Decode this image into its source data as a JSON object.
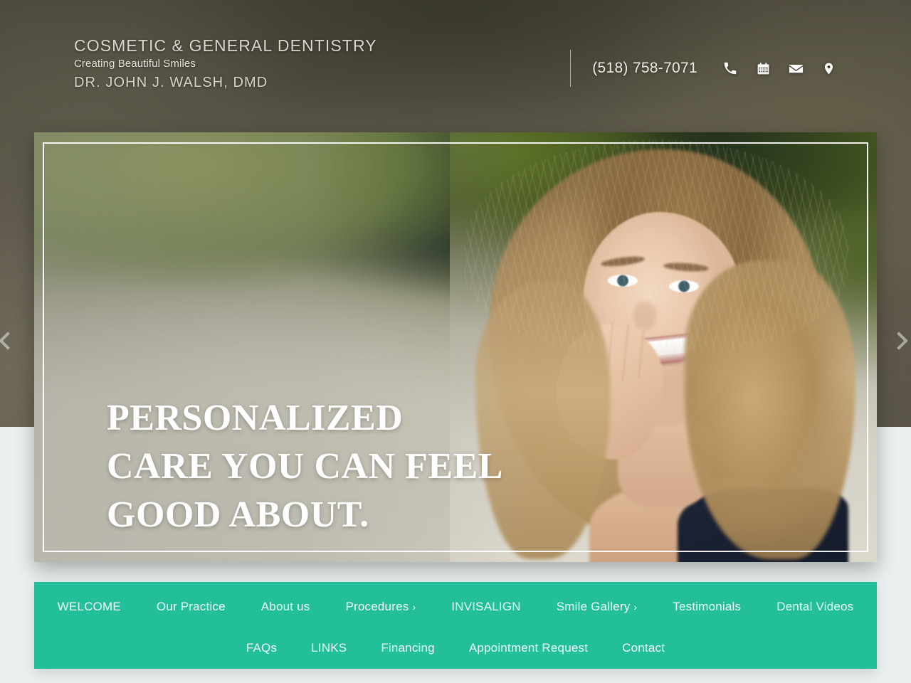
{
  "brand": {
    "line1": "COSMETIC & GENERAL DENTISTRY",
    "line2": "Creating Beautiful Smiles",
    "line3": "DR. JOHN J. WALSH, DMD"
  },
  "header": {
    "phone": "(518) 758-7071",
    "icons": [
      {
        "name": "phone-icon",
        "label": "Call"
      },
      {
        "name": "calendar-icon",
        "label": "Appointments"
      },
      {
        "name": "envelope-icon",
        "label": "Email"
      },
      {
        "name": "map-pin-icon",
        "label": "Location"
      }
    ]
  },
  "hero": {
    "headline_line1": "PERSONALIZED",
    "headline_line2": "CARE YOU CAN FEEL",
    "headline_line3": "GOOD ABOUT.",
    "slide_count": 3,
    "active_slide": 1,
    "prev_arrow": "‹",
    "next_arrow": "›",
    "image_alt": "Smiling young woman with long blonde hair resting her chin on her hand outdoors"
  },
  "nav": {
    "row1": [
      {
        "label": "WELCOME",
        "has_submenu": false
      },
      {
        "label": "Our Practice",
        "has_submenu": false
      },
      {
        "label": "About us",
        "has_submenu": false
      },
      {
        "label": "Procedures",
        "has_submenu": true,
        "chevron": "›"
      },
      {
        "label": "INVISALIGN",
        "has_submenu": false
      },
      {
        "label": "Smile Gallery",
        "has_submenu": true,
        "chevron": "›"
      },
      {
        "label": "Testimonials",
        "has_submenu": false
      },
      {
        "label": "Dental Videos",
        "has_submenu": false
      }
    ],
    "row2": [
      {
        "label": "FAQs",
        "has_submenu": false
      },
      {
        "label": "LINKS",
        "has_submenu": false
      },
      {
        "label": "Financing",
        "has_submenu": false
      },
      {
        "label": "Appointment Request",
        "has_submenu": false
      },
      {
        "label": "Contact",
        "has_submenu": false
      }
    ]
  },
  "colors": {
    "nav_green": "#22bf9a",
    "page_background": "#eaf0f0",
    "header_text": "#d8d6cf",
    "hero_text": "#ffffff"
  }
}
